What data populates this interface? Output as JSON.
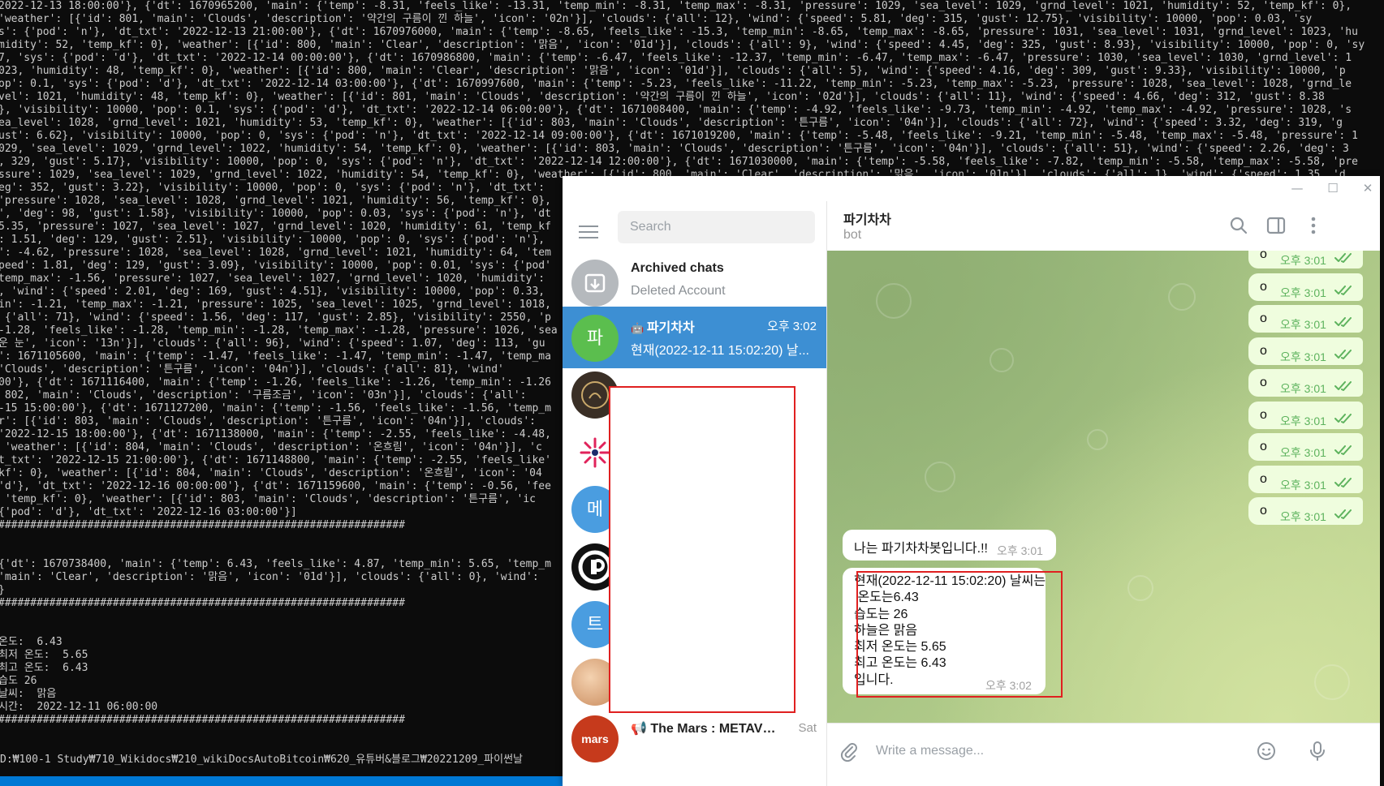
{
  "terminal": {
    "lines": [
      "2022-12-13 18:00:00'}, {'dt': 1670965200, 'main': {'temp': -8.31, 'feels_like': -13.31, 'temp_min': -8.31, 'temp_max': -8.31, 'pressure': 1029, 'sea_level': 1029, 'grnd_level': 1021, 'humidity': 52, 'temp_kf': 0},",
      "'weather': [{'id': 801, 'main': 'Clouds', 'description': '약간의 구름이 낀 하늘', 'icon': '02n'}], 'clouds': {'all': 12}, 'wind': {'speed': 5.81, 'deg': 315, 'gust': 12.75}, 'visibility': 10000, 'pop': 0.03, 'sy",
      "s': {'pod': 'n'}, 'dt_txt': '2022-12-13 21:00:00'}, {'dt': 1670976000, 'main': {'temp': -8.65, 'feels_like': -15.3, 'temp_min': -8.65, 'temp_max': -8.65, 'pressure': 1031, 'sea_level': 1031, 'grnd_level': 1023, 'hu",
      "midity': 52, 'temp_kf': 0}, 'weather': [{'id': 800, 'main': 'Clear', 'description': '맑음', 'icon': '01d'}], 'clouds': {'all': 9}, 'wind': {'speed': 4.45, 'deg': 325, 'gust': 8.93}, 'visibility': 10000, 'pop': 0, 'sy",
      "7, 'sys': {'pod': 'd'}, 'dt_txt': '2022-12-14 00:00:00'}, {'dt': 1670986800, 'main': {'temp': -6.47, 'feels_like': -12.37, 'temp_min': -6.47, 'temp_max': -6.47, 'pressure': 1030, 'sea_level': 1030, 'grnd_level': 1",
      "023, 'humidity': 48, 'temp_kf': 0}, 'weather': [{'id': 800, 'main': 'Clear', 'description': '맑음', 'icon': '01d'}], 'clouds': {'all': 5}, 'wind': {'speed': 4.16, 'deg': 309, 'gust': 9.33}, 'visibility': 10000, 'p",
      "op': 0.1, 'sys': {'pod': 'd'}, 'dt_txt': '2022-12-14 03:00:00'}, {'dt': 1670997600, 'main': {'temp': -5.23, 'feels_like': -11.22, 'temp_min': -5.23, 'temp_max': -5.23, 'pressure': 1028, 'sea_level': 1028, 'grnd_le",
      "vel': 1021, 'humidity': 48, 'temp_kf': 0}, 'weather': [{'id': 801, 'main': 'Clouds', 'description': '약간의 구름이 낀 하늘', 'icon': '02d'}], 'clouds': {'all': 11}, 'wind': {'speed': 4.66, 'deg': 312, 'gust': 8.38",
      "}, 'visibility': 10000, 'pop': 0.1, 'sys': {'pod': 'd'}, 'dt_txt': '2022-12-14 06:00:00'}, {'dt': 1671008400, 'main': {'temp': -4.92, 'feels_like': -9.73, 'temp_min': -4.92, 'temp_max': -4.92, 'pressure': 1028, 's",
      "ea_level': 1028, 'grnd_level': 1021, 'humidity': 53, 'temp_kf': 0}, 'weather': [{'id': 803, 'main': 'Clouds', 'description': '튼구름', 'icon': '04n'}], 'clouds': {'all': 72}, 'wind': {'speed': 3.32, 'deg': 319, 'g",
      "ust': 6.62}, 'visibility': 10000, 'pop': 0, 'sys': {'pod': 'n'}, 'dt_txt': '2022-12-14 09:00:00'}, {'dt': 1671019200, 'main': {'temp': -5.48, 'feels_like': -9.21, 'temp_min': -5.48, 'temp_max': -5.48, 'pressure': 1",
      "029, 'sea_level': 1029, 'grnd_level': 1022, 'humidity': 54, 'temp_kf': 0}, 'weather': [{'id': 803, 'main': 'Clouds', 'description': '튼구름', 'icon': '04n'}], 'clouds': {'all': 51}, 'wind': {'speed': 2.26, 'deg': 3",
      ", 329, 'gust': 5.17}, 'visibility': 10000, 'pop': 0, 'sys': {'pod': 'n'}, 'dt_txt': '2022-12-14 12:00:00'}, {'dt': 1671030000, 'main': {'temp': -5.58, 'feels_like': -7.82, 'temp_min': -5.58, 'temp_max': -5.58, 'pre",
      "ssure': 1029, 'sea_level': 1029, 'grnd_level': 1022, 'humidity': 54, 'temp_kf': 0}, 'weather': [{'id': 800, 'main': 'Clear', 'description': '맑음', 'icon': '01n'}], 'clouds': {'all': 1}, 'wind': {'speed': 1.35, 'd",
      "eg': 352, 'gust': 3.22}, 'visibility': 10000, 'pop': 0, 'sys': {'pod': 'n'}, 'dt_txt':",
      "'pressure': 1028, 'sea_level': 1028, 'grnd_level': 1021, 'humidity': 56, 'temp_kf': 0},",
      "', 'deg': 98, 'gust': 1.58}, 'visibility': 10000, 'pop': 0.03, 'sys': {'pod': 'n'}, 'dt",
      "5.35, 'pressure': 1027, 'sea_level': 1027, 'grnd_level': 1020, 'humidity': 61, 'temp_kf",
      ": 1.51, 'deg': 129, 'gust': 2.51}, 'visibility': 10000, 'pop': 0, 'sys': {'pod': 'n'},",
      "': -4.62, 'pressure': 1028, 'sea_level': 1028, 'grnd_level': 1021, 'humidity': 64, 'tem",
      "peed': 1.81, 'deg': 129, 'gust': 3.09}, 'visibility': 10000, 'pop': 0.01, 'sys': {'pod'",
      "temp_max': -1.56, 'pressure': 1027, 'sea_level': 1027, 'grnd_level': 1020, 'humidity':",
      ", 'wind': {'speed': 2.01, 'deg': 169, 'gust': 4.51}, 'visibility': 10000, 'pop': 0.33,",
      "in': -1.21, 'temp_max': -1.21, 'pressure': 1025, 'sea_level': 1025, 'grnd_level': 1018,",
      " {'all': 71}, 'wind': {'speed': 1.56, 'deg': 117, 'gust': 2.85}, 'visibility': 2550, 'p",
      "-1.28, 'feels_like': -1.28, 'temp_min': -1.28, 'temp_max': -1.28, 'pressure': 1026, 'sea",
      "운 눈', 'icon': '13n'}], 'clouds': {'all': 96}, 'wind': {'speed': 1.07, 'deg': 113, 'gu",
      "': 1671105600, 'main': {'temp': -1.47, 'feels_like': -1.47, 'temp_min': -1.47, 'temp_ma",
      "'Clouds', 'description': '튼구름', 'icon': '04n'}], 'clouds': {'all': 81}, 'wind'",
      "00'}, {'dt': 1671116400, 'main': {'temp': -1.26, 'feels_like': -1.26, 'temp_min': -1.26",
      " 802, 'main': 'Clouds', 'description': '구름조금', 'icon': '03n'}], 'clouds': {'all':",
      "-15 15:00:00'}, {'dt': 1671127200, 'main': {'temp': -1.56, 'feels_like': -1.56, 'temp_m",
      "r': [{'id': 803, 'main': 'Clouds', 'description': '튼구름', 'icon': '04n'}], 'clouds':",
      "'2022-12-15 18:00:00'}, {'dt': 1671138000, 'main': {'temp': -2.55, 'feels_like': -4.48,",
      " 'weather': [{'id': 804, 'main': 'Clouds', 'description': '온흐림', 'icon': '04n'}], 'c",
      "t_txt': '2022-12-15 21:00:00'}, {'dt': 1671148800, 'main': {'temp': -2.55, 'feels_like'",
      "kf': 0}, 'weather': [{'id': 804, 'main': 'Clouds', 'description': '온흐림', 'icon': '04",
      "'d'}, 'dt_txt': '2022-12-16 00:00:00'}, {'dt': 1671159600, 'main': {'temp': -0.56, 'fee",
      " 'temp_kf': 0}, 'weather': [{'id': 803, 'main': 'Clouds', 'description': '튼구름', 'ic",
      "{'pod': 'd'}, 'dt_txt': '2022-12-16 03:00:00'}]",
      "################################################################",
      "",
      "",
      "{'dt': 1670738400, 'main': {'temp': 6.43, 'feels_like': 4.87, 'temp_min': 5.65, 'temp_m",
      "'main': 'Clear', 'description': '맑음', 'icon': '01d'}], 'clouds': {'all': 0}, 'wind':",
      "}",
      "################################################################",
      "",
      "",
      "온도:  6.43",
      "최저 온도:  5.65",
      "최고 온도:  6.43",
      "습도 26",
      "날씨:  맑음",
      "시간:  2022-12-11 06:00:00",
      "################################################################"
    ],
    "path": "D:₩100-1 Study₩710_Wikidocs₩210_wikiDocsAutoBitcoin₩620_유튜버&블로그₩20221209_파이썬날"
  },
  "telegram": {
    "window_controls": {
      "minimize": "—",
      "maximize": "☐",
      "close": "✕"
    },
    "search_placeholder": "Search",
    "chats": [
      {
        "name": "Archived chats",
        "preview": "Deleted Account",
        "time": "",
        "avatar_icon": "archive-icon",
        "avatar_color": "#b5b9bd"
      },
      {
        "name": "파기차차",
        "preview": "현재(2022-12-11 15:02:20) 날...",
        "time": "오후 3:02",
        "avatar_letter": "파",
        "avatar_color": "#5bbe4e",
        "bot_icon": "bot-icon"
      },
      {
        "name": "",
        "avatar_color": "#3a2f26",
        "avatar_icon": "emblem-icon"
      },
      {
        "name": "",
        "avatar_color": "#ffffff",
        "avatar_icon": "spark-icon"
      },
      {
        "name": "",
        "avatar_letter": "메",
        "avatar_color": "#4a9de0"
      },
      {
        "name": "",
        "avatar_color": "#111111",
        "avatar_icon": "ring-logo-icon"
      },
      {
        "name": "",
        "avatar_letter": "트",
        "avatar_color": "#4a9de0"
      },
      {
        "name": "",
        "avatar_color": "#e8b48a",
        "avatar_icon": "photo-icon"
      },
      {
        "name": "📢 The Mars : METAVER...",
        "preview": "",
        "time": "Sat",
        "avatar_color": "#c63a1c",
        "avatar_text": "mars"
      }
    ],
    "header": {
      "title": "파기차차",
      "status": "bot"
    },
    "outgoing": [
      {
        "text": "o",
        "time": "오후 3:01"
      },
      {
        "text": "o",
        "time": "오후 3:01"
      },
      {
        "text": "o",
        "time": "오후 3:01"
      },
      {
        "text": "o",
        "time": "오후 3:01"
      },
      {
        "text": "o",
        "time": "오후 3:01"
      },
      {
        "text": "o",
        "time": "오후 3:01"
      },
      {
        "text": "o",
        "time": "오후 3:01"
      },
      {
        "text": "o",
        "time": "오후 3:01"
      },
      {
        "text": "o",
        "time": "오후 3:01"
      }
    ],
    "incoming": [
      {
        "text": "나는 파기차차봇입니다.!!",
        "time": "오후 3:01"
      },
      {
        "text": "현재(2022-12-11 15:02:20) 날씨는\n 온도는6.43\n습도는 26\n하늘은 맑음\n최저 온도는 5.65\n최고 온도는 6.43\n입니다.",
        "time": "오후 3:02"
      }
    ],
    "composer_placeholder": "Write a message..."
  }
}
